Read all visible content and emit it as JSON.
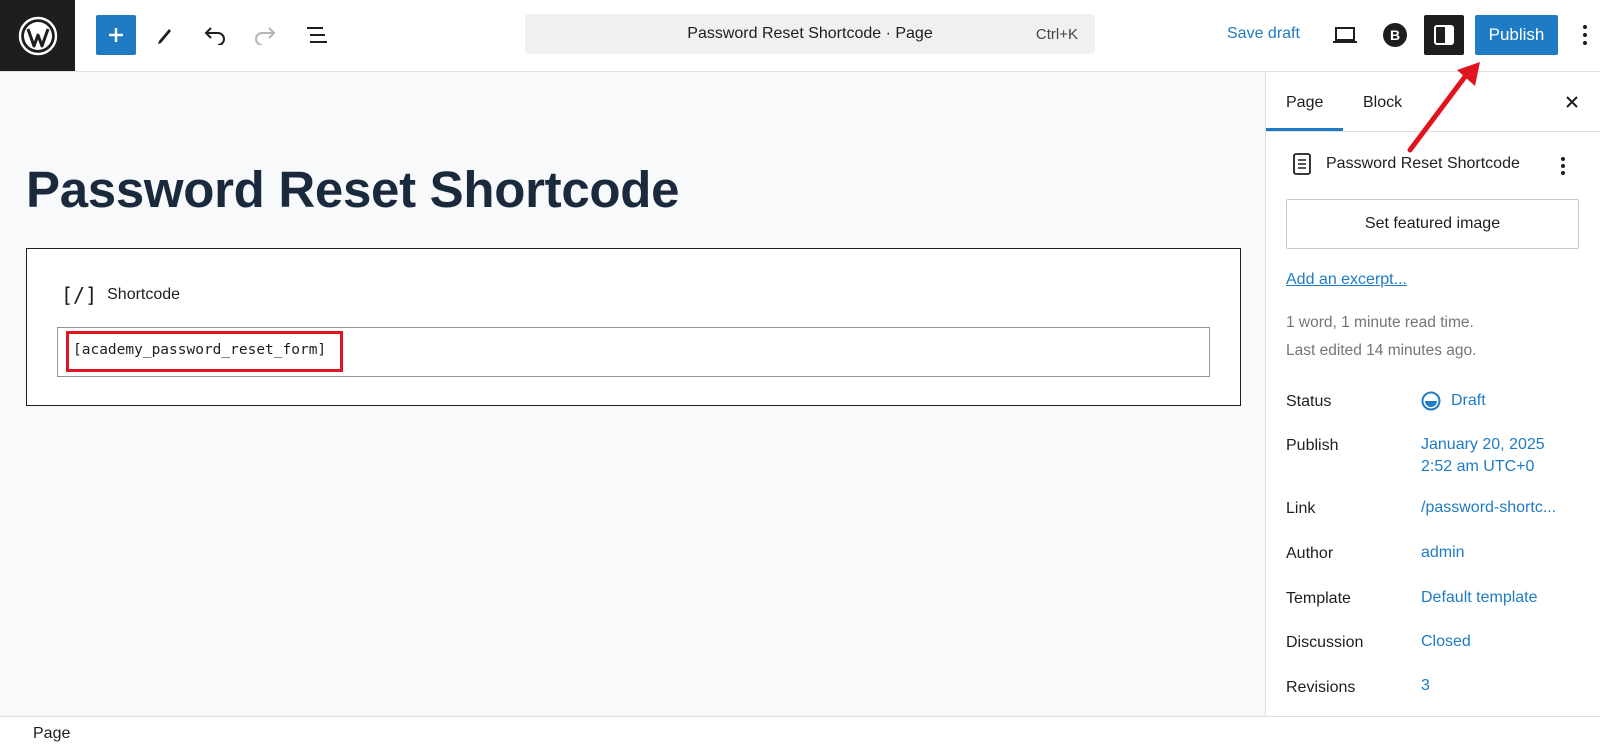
{
  "header": {
    "command_title": "Password Reset Shortcode · Page",
    "command_shortcut": "Ctrl+K",
    "save_draft": "Save draft",
    "publish": "Publish"
  },
  "editor": {
    "title": "Password Reset Shortcode",
    "block_icon": "[/]",
    "block_label": "Shortcode",
    "shortcode_value": "[academy_password_reset_form]"
  },
  "sidebar": {
    "tabs": [
      "Page",
      "Block"
    ],
    "doc_title": "Password Reset Shortcode",
    "featured_image_button": "Set featured image",
    "excerpt_link": "Add an excerpt...",
    "meta_words": "1 word, 1 minute read time.",
    "meta_edited": "Last edited 14 minutes ago.",
    "rows": [
      {
        "label": "Status",
        "value": "Draft"
      },
      {
        "label": "Publish",
        "value": "January 20, 2025",
        "value2": "2:52 am UTC+0"
      },
      {
        "label": "Link",
        "value": "/password-shortc..."
      },
      {
        "label": "Author",
        "value": "admin"
      },
      {
        "label": "Template",
        "value": "Default template"
      },
      {
        "label": "Discussion",
        "value": "Closed"
      },
      {
        "label": "Revisions",
        "value": "3"
      }
    ]
  },
  "footer": {
    "breadcrumb": "Page"
  },
  "colors": {
    "accent": "#1e7bc4",
    "annotation": "#e0141e"
  },
  "icons": [
    "wordpress-logo",
    "plus-icon",
    "pen-icon",
    "undo-icon",
    "redo-icon",
    "list-view-icon",
    "desktop-preview-icon",
    "plugin-b-icon",
    "settings-sidebar-icon",
    "more-vertical-icon",
    "close-icon",
    "page-icon",
    "draft-status-icon"
  ]
}
